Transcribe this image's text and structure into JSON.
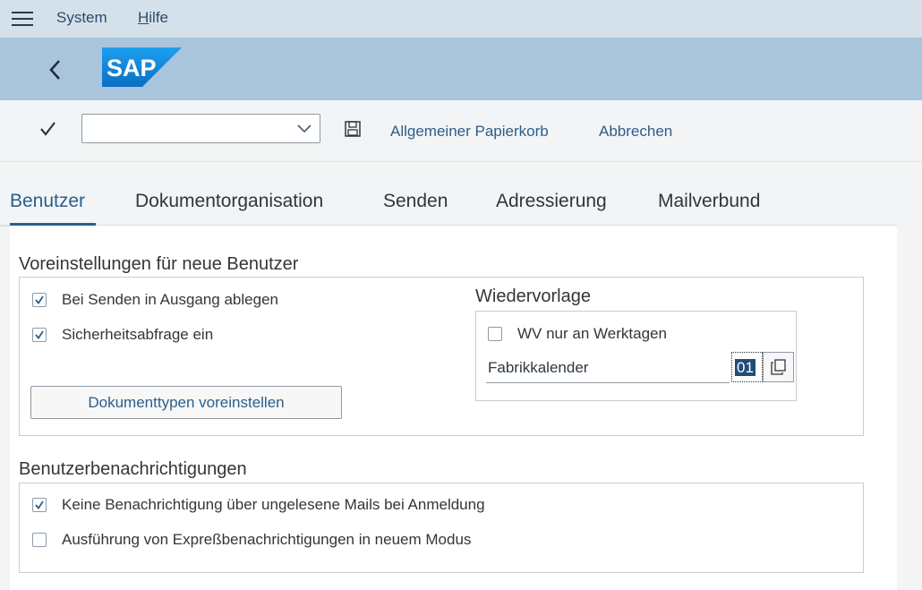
{
  "menubar": {
    "system": "System",
    "hilfe_pre": "",
    "hilfe_u": "H",
    "hilfe_rest": "ilfe"
  },
  "shell": {
    "logo_text": "SAP"
  },
  "toolbar": {
    "combo_value": "",
    "papierkorb": "Allgemeiner Papierkorb",
    "abbrechen": "Abbrechen"
  },
  "tabs": [
    "Benutzer",
    "Dokumentorganisation",
    "Senden",
    "Adressierung",
    "Mailverbund"
  ],
  "voreinstellungen": {
    "title": "Voreinstellungen für neue Benutzer",
    "cb1": {
      "label": "Bei Senden in Ausgang ablegen",
      "checked": true
    },
    "cb2": {
      "label": "Sicherheitsabfrage ein",
      "checked": true
    },
    "button": "Dokumenttypen voreinstellen"
  },
  "wiedervorlage": {
    "title": "Wiedervorlage",
    "cb": {
      "label": "WV nur an Werktagen",
      "checked": false
    },
    "field_label": "Fabrikkalender",
    "field_value": "01"
  },
  "benachrichtigungen": {
    "title": "Benutzerbenachrichtigungen",
    "cb1": {
      "label": "Keine Benachrichtigung über ungelesene Mails bei Anmeldung",
      "checked": true
    },
    "cb2": {
      "label": "Ausführung von Expreßbenachrichtigungen in neuem Modus",
      "checked": false
    }
  },
  "colors": {
    "menubar_bg": "#d5e1ea",
    "shellbar_bg": "#a9c5db",
    "logo_blue": "#0a7fd6",
    "link_blue": "#2b5f8c"
  }
}
